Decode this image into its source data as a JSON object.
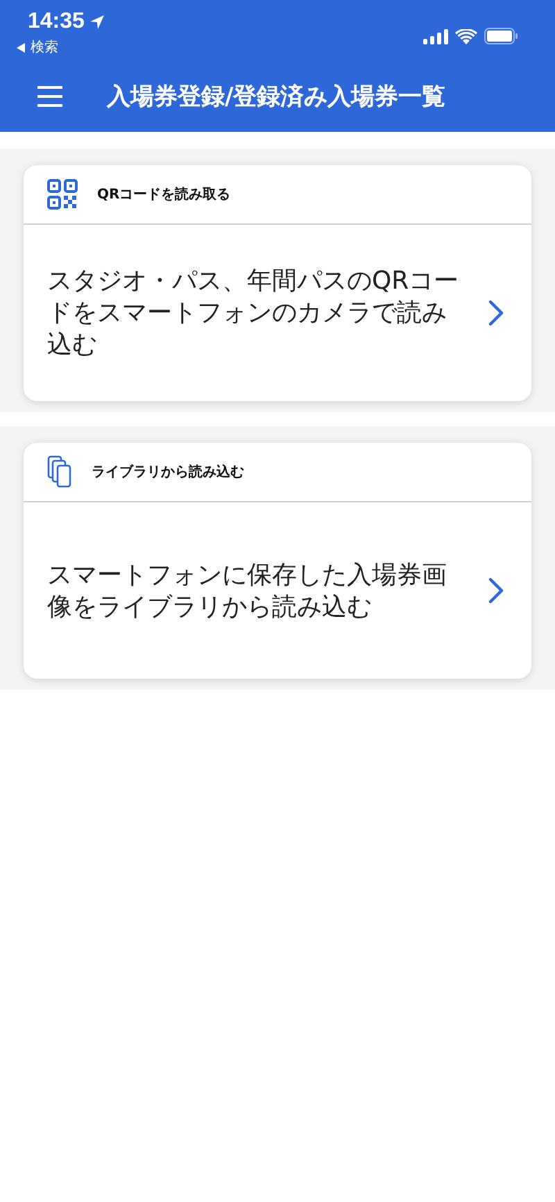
{
  "status_bar": {
    "time": "14:35",
    "back_label": "検索"
  },
  "nav_bar": {
    "title": "入場券登録/登録済み入場券一覧"
  },
  "cards": [
    {
      "kind": "qr",
      "title": "QRコードを読み取る",
      "description": "スタジオ・パス、年間パスのQRコードをスマートフォンのカメラで読み込む"
    },
    {
      "kind": "library",
      "title": "ライブラリから読み込む",
      "description": "スマートフォンに保存した入場券画像をライブラリから読み込む"
    }
  ]
}
